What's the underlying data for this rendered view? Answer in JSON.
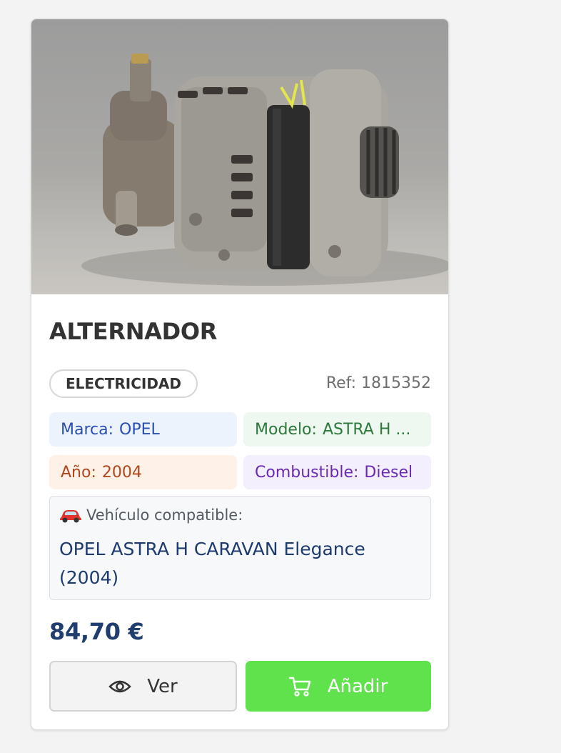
{
  "product": {
    "name": "ALTERNADOR",
    "category": "ELECTRICIDAD",
    "ref": "Ref: 1815352",
    "image_alt": "alternator-photo"
  },
  "attributes": {
    "brand": {
      "label": "Marca:",
      "value": "OPEL"
    },
    "model": {
      "label": "Modelo:",
      "value": "ASTRA H ..."
    },
    "year": {
      "label": "Año:",
      "value": "2004"
    },
    "fuel": {
      "label": "Combustible:",
      "value": "Diesel"
    }
  },
  "compatibility": {
    "heading": "Vehículo compatible:",
    "vehicle": "OPEL ASTRA H CARAVAN Elegance (2004)",
    "icon": "car-icon"
  },
  "price": "84,70 €",
  "actions": {
    "view_label": "Ver",
    "view_icon": "eye-icon",
    "add_label": "Añadir",
    "add_icon": "cart-icon"
  },
  "colors": {
    "add_button": "#5fe24b",
    "price": "#1f3d6e",
    "brand_chip": "#edf3fc",
    "model_chip": "#eef8f0",
    "year_chip": "#fdf1e8",
    "fuel_chip": "#f4effc"
  }
}
